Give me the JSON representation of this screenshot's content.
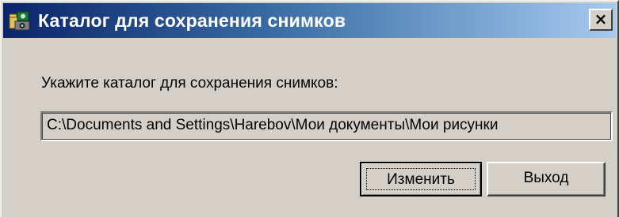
{
  "window": {
    "title": "Каталог для сохранения снимков",
    "close_glyph": "×",
    "icon": "folder-camera-icon"
  },
  "dialog": {
    "prompt": "Укажите каталог для сохранения снимков:",
    "path_value": "C:\\Documents and Settings\\Harebov\\Мои документы\\Мои рисунки"
  },
  "buttons": {
    "change_label": "Изменить",
    "exit_label": "Выход"
  },
  "colors": {
    "titlebar_start": "#0a246a",
    "titlebar_end": "#a6caf0",
    "face": "#d4d0c8"
  }
}
